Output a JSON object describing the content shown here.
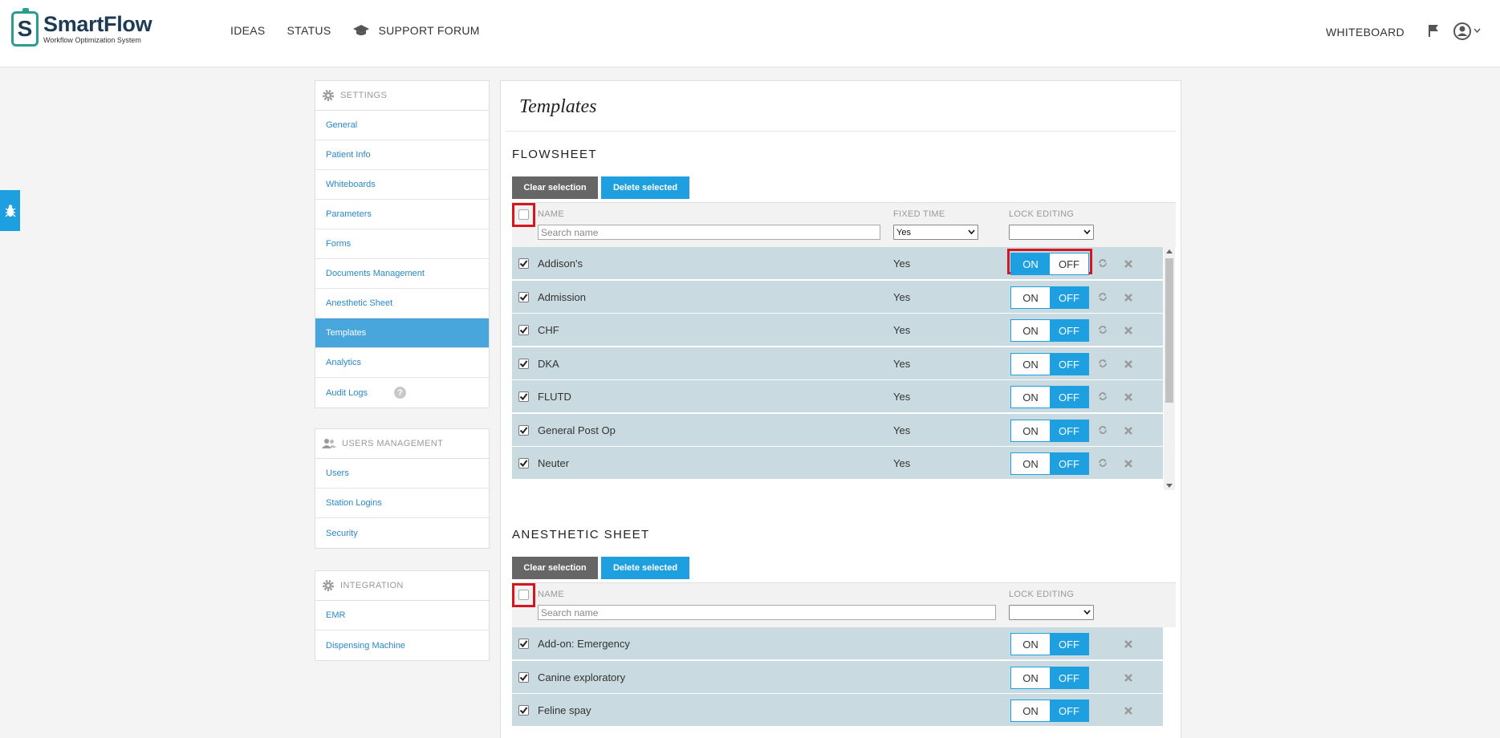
{
  "header": {
    "app_name": "SmartFlow",
    "app_tagline": "Workflow Optimization System",
    "logo_letter": "S",
    "nav": [
      "IDEAS",
      "STATUS",
      "SUPPORT FORUM"
    ],
    "whiteboard": "WHITEBOARD"
  },
  "sidebar": {
    "settings": {
      "title": "SETTINGS",
      "items": [
        "General",
        "Patient Info",
        "Whiteboards",
        "Parameters",
        "Forms",
        "Documents Management",
        "Anesthetic Sheet",
        "Templates",
        "Analytics",
        "Audit Logs"
      ],
      "active": "Templates",
      "help_glyph": "?"
    },
    "users": {
      "title": "USERS MANAGEMENT",
      "items": [
        "Users",
        "Station Logins",
        "Security"
      ]
    },
    "integration": {
      "title": "INTEGRATION",
      "items": [
        "EMR",
        "Dispensing Machine"
      ]
    }
  },
  "main": {
    "title": "Templates",
    "flowsheet": {
      "title": "FLOWSHEET",
      "clear_label": "Clear selection",
      "delete_label": "Delete selected",
      "col_name": "NAME",
      "col_fixed": "FIXED TIME",
      "col_lock": "LOCK EDITING",
      "search_placeholder": "Search name",
      "fixed_filter": "Yes",
      "lock_filter": "",
      "on_label": "ON",
      "off_label": "OFF",
      "rows": [
        {
          "name": "Addison's",
          "fixed": "Yes",
          "lock": "ON"
        },
        {
          "name": "Admission",
          "fixed": "Yes",
          "lock": "OFF"
        },
        {
          "name": "CHF",
          "fixed": "Yes",
          "lock": "OFF"
        },
        {
          "name": "DKA",
          "fixed": "Yes",
          "lock": "OFF"
        },
        {
          "name": "FLUTD",
          "fixed": "Yes",
          "lock": "OFF"
        },
        {
          "name": "General Post Op",
          "fixed": "Yes",
          "lock": "OFF"
        },
        {
          "name": "Neuter",
          "fixed": "Yes",
          "lock": "OFF"
        }
      ]
    },
    "anesthetic": {
      "title": "ANESTHETIC SHEET",
      "clear_label": "Clear selection",
      "delete_label": "Delete selected",
      "col_name": "NAME",
      "col_lock": "LOCK EDITING",
      "search_placeholder": "Search name",
      "lock_filter": "",
      "on_label": "ON",
      "off_label": "OFF",
      "rows": [
        {
          "name": "Add-on: Emergency",
          "lock": "OFF"
        },
        {
          "name": "Canine exploratory",
          "lock": "OFF"
        },
        {
          "name": "Feline spay",
          "lock": "OFF"
        }
      ]
    }
  },
  "colors": {
    "accent": "#1e9fe0",
    "active_nav": "#49a6dd",
    "row_bg": "#c9dbe0",
    "highlight": "#d7151f",
    "brand": "#1d3b53"
  }
}
